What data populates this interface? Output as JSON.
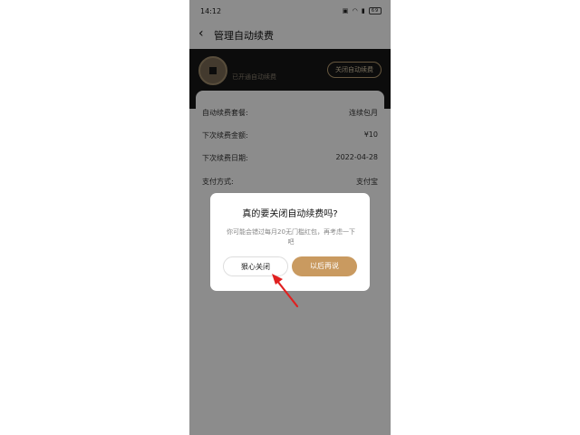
{
  "status_bar": {
    "time": "14:12",
    "battery": "69"
  },
  "header": {
    "title": "管理自动续费"
  },
  "banner": {
    "status_text": "已开通自动续费",
    "close_button": "关闭自动续费"
  },
  "details": {
    "rows": [
      {
        "label": "自动续费套餐:",
        "value": "连续包月"
      },
      {
        "label": "下次续费金额:",
        "value": "¥10"
      },
      {
        "label": "下次续费日期:",
        "value": "2022-04-28"
      },
      {
        "label": "支付方式:",
        "value": "支付宝"
      }
    ]
  },
  "dialog": {
    "title": "真的要关闭自动续费吗?",
    "message": "你可能会错过每月20无门槛红包，再考虑一下吧",
    "confirm_button": "狠心关闭",
    "cancel_button": "以后再说"
  },
  "colors": {
    "accent": "#c99a60",
    "annotation": "#e02020",
    "banner_bg": "#161616"
  }
}
